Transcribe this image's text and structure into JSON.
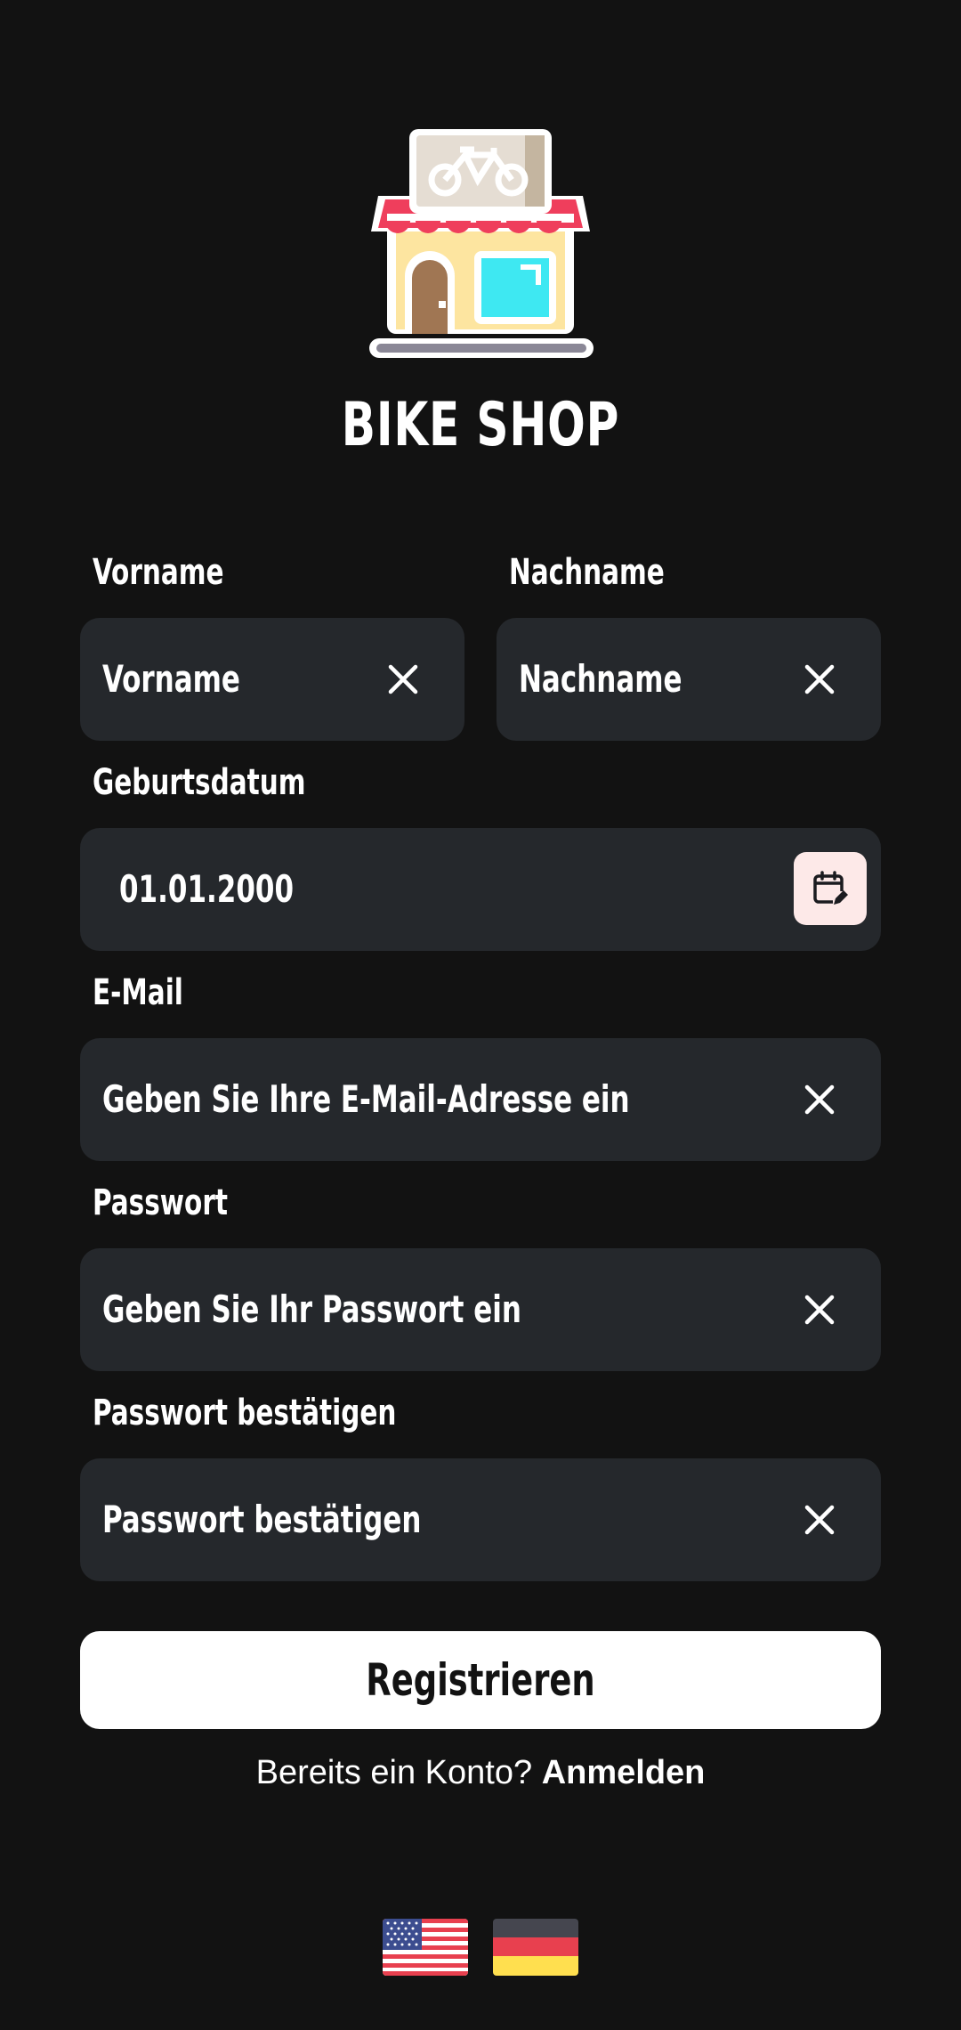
{
  "app": {
    "title": "BIKE SHOP"
  },
  "form": {
    "first_name": {
      "label": "Vorname",
      "placeholder": "Vorname"
    },
    "last_name": {
      "label": "Nachname",
      "placeholder": "Nachname"
    },
    "birthdate": {
      "label": "Geburtsdatum",
      "value": "01.01.2000"
    },
    "email": {
      "label": "E-Mail",
      "placeholder": "Geben Sie Ihre E-Mail-Adresse ein"
    },
    "password": {
      "label": "Passwort",
      "placeholder": "Geben Sie Ihr Passwort ein"
    },
    "confirm_password": {
      "label": "Passwort bestätigen",
      "placeholder": "Passwort bestätigen"
    }
  },
  "actions": {
    "register_label": "Registrieren",
    "login_prompt": "Bereits ein Konto? ",
    "login_link": "Anmelden"
  },
  "languages": [
    {
      "icon": "us-flag-icon"
    },
    {
      "icon": "de-flag-icon"
    }
  ],
  "colors": {
    "background": "#121212",
    "field_background": "#25282c",
    "button_background": "#ffffff",
    "calendar_button_background": "#fde9e8"
  }
}
